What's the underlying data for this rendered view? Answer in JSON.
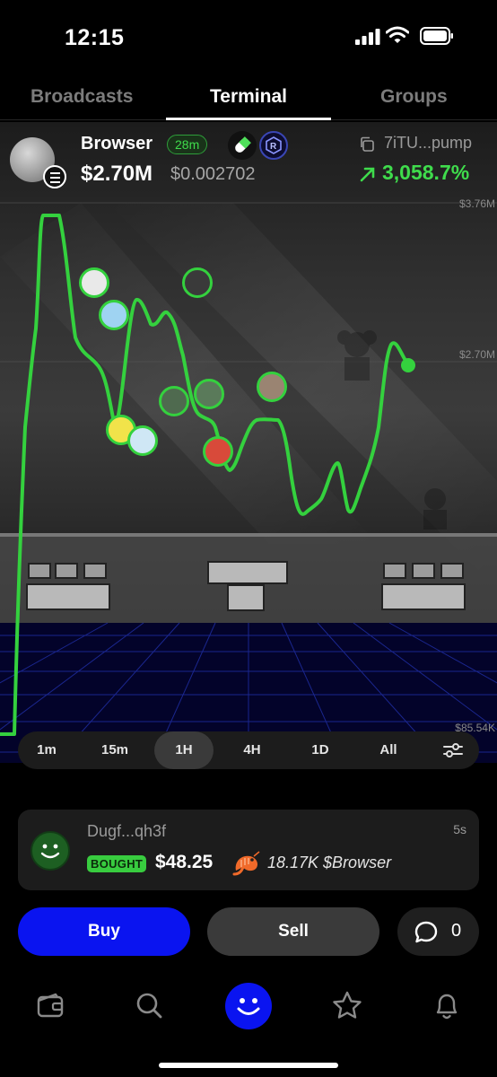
{
  "status_bar": {
    "time": "12:15"
  },
  "tabs": [
    {
      "label": "Broadcasts",
      "active": false
    },
    {
      "label": "Terminal",
      "active": true
    },
    {
      "label": "Groups",
      "active": false
    }
  ],
  "token": {
    "name": "Browser",
    "age": "28m",
    "market_cap": "$2.70M",
    "price": "$0.002702",
    "address": "7iTU...pump",
    "change": "3,058.7%",
    "icons": [
      "solana-icon",
      "pill-icon",
      "raydium-icon"
    ]
  },
  "chart": {
    "y_labels": {
      "high": "$3.76M",
      "mid": "$2.70M",
      "low": "$85.54K"
    },
    "accent": "#34d13e"
  },
  "ranges": [
    {
      "label": "1m",
      "selected": false
    },
    {
      "label": "15m",
      "selected": false
    },
    {
      "label": "1H",
      "selected": true
    },
    {
      "label": "4H",
      "selected": false
    },
    {
      "label": "1D",
      "selected": false
    },
    {
      "label": "All",
      "selected": false
    }
  ],
  "trade": {
    "user": "Dugf...qh3f",
    "ago": "5s",
    "action": "BOUGHT",
    "amount": "$48.25",
    "tokens": "18.17K $Browser"
  },
  "actions": {
    "buy": "Buy",
    "sell": "Sell",
    "chat_count": "0"
  },
  "colors": {
    "buy": "#0a14f0",
    "positive": "#3fdc4c",
    "background": "#000000"
  }
}
